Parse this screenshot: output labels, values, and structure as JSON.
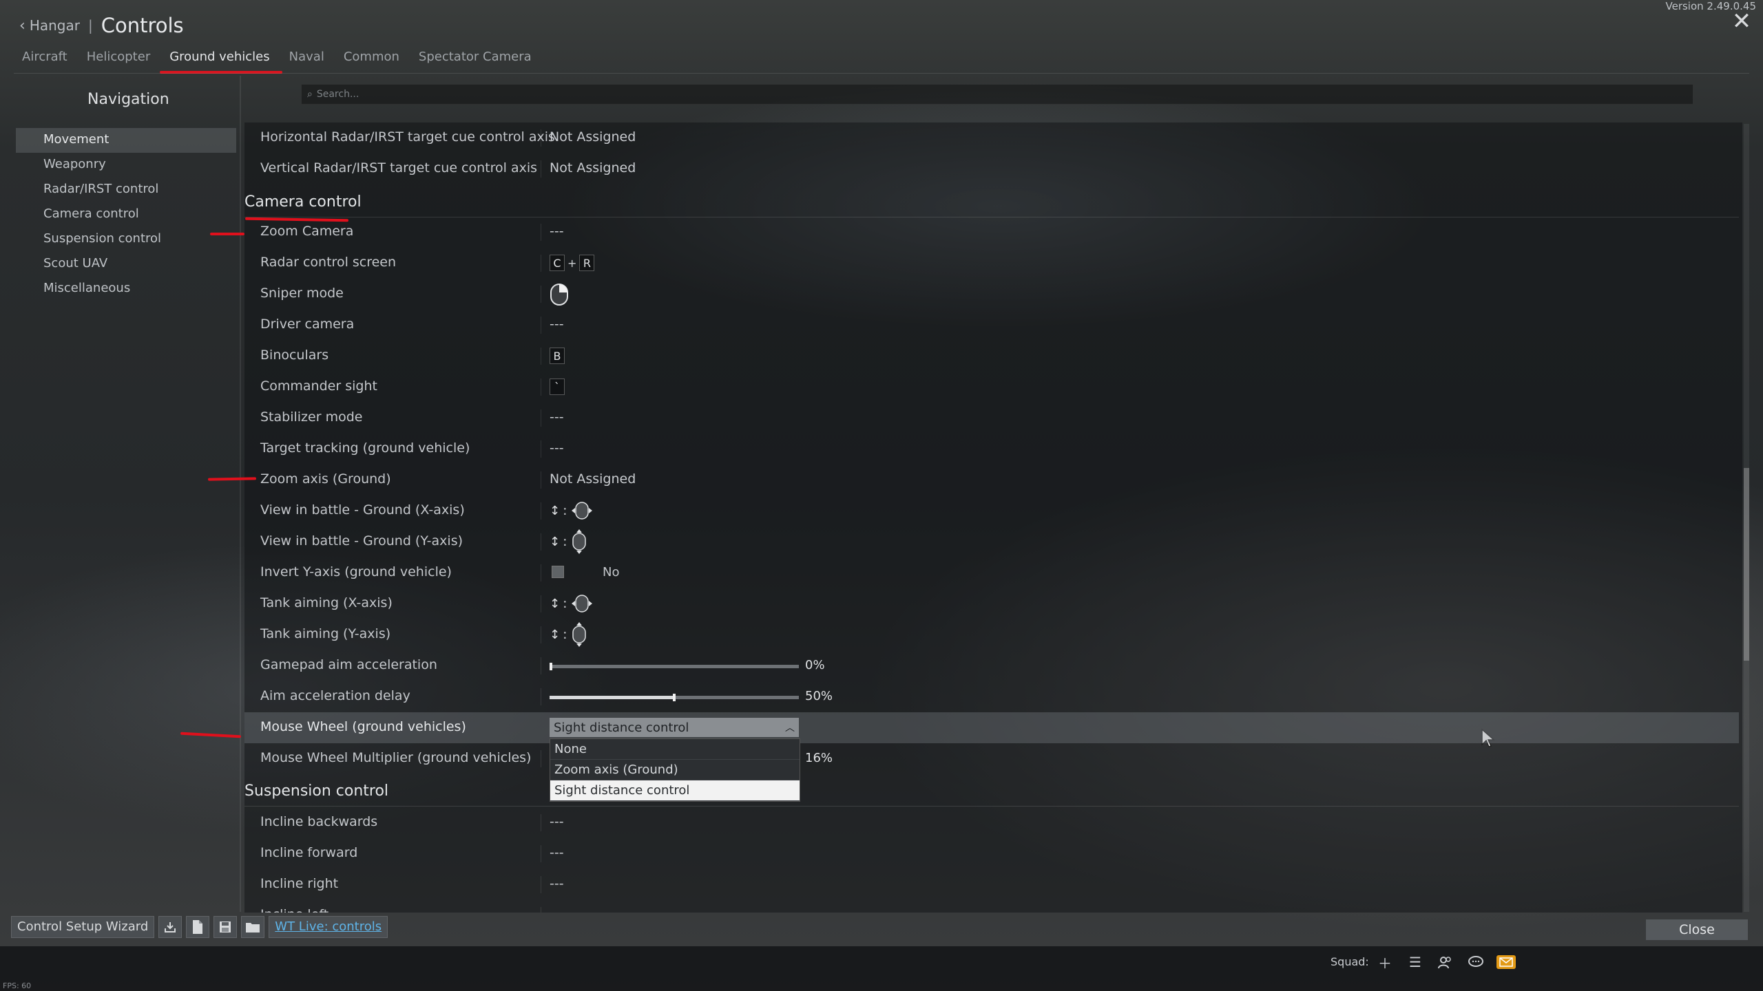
{
  "header": {
    "version": "Version 2.49.0.45",
    "back_label": "Hangar",
    "title_separator": "|",
    "title": "Controls"
  },
  "tabs": [
    {
      "label": "Aircraft",
      "active": false
    },
    {
      "label": "Helicopter",
      "active": false
    },
    {
      "label": "Ground vehicles",
      "active": true
    },
    {
      "label": "Naval",
      "active": false
    },
    {
      "label": "Common",
      "active": false
    },
    {
      "label": "Spectator Camera",
      "active": false
    }
  ],
  "search": {
    "placeholder": "Search..."
  },
  "nav": {
    "title": "Navigation",
    "items": [
      {
        "label": "Movement",
        "active": true
      },
      {
        "label": "Weaponry",
        "active": false
      },
      {
        "label": "Radar/IRST control",
        "active": false
      },
      {
        "label": "Camera control",
        "active": false
      },
      {
        "label": "Suspension control",
        "active": false
      },
      {
        "label": "Scout UAV",
        "active": false
      },
      {
        "label": "Miscellaneous",
        "active": false
      }
    ]
  },
  "rows_top": [
    {
      "label": "Horizontal Radar/IRST target cue control axis",
      "value": "Not Assigned"
    },
    {
      "label": "Vertical Radar/IRST target cue control axis",
      "value": "Not Assigned"
    }
  ],
  "camera_section": {
    "title": "Camera control",
    "zoom_camera": {
      "label": "Zoom Camera",
      "value": "---"
    },
    "radar_screen": {
      "label": "Radar control screen",
      "key1": "C",
      "plus": "+",
      "key2": "R"
    },
    "sniper": {
      "label": "Sniper mode",
      "icon": "mouse-right-button-icon"
    },
    "driver": {
      "label": "Driver camera",
      "value": "---"
    },
    "binoculars": {
      "label": "Binoculars",
      "key": "B"
    },
    "commander": {
      "label": "Commander sight",
      "key": "`"
    },
    "stabilizer": {
      "label": "Stabilizer mode",
      "value": "---"
    },
    "tracking": {
      "label": "Target tracking (ground vehicle)",
      "value": "---"
    },
    "zoom_axis": {
      "label": "Zoom axis (Ground)",
      "value": "Not Assigned"
    },
    "view_x": {
      "label": "View in battle - Ground (X-axis)",
      "colon": ":"
    },
    "view_y": {
      "label": "View in battle - Ground (Y-axis)",
      "colon": ":"
    },
    "invert_y": {
      "label": "Invert Y-axis (ground vehicle)",
      "value": "No",
      "checked": false
    },
    "tank_x": {
      "label": "Tank aiming (X-axis)",
      "colon": ":"
    },
    "tank_y": {
      "label": "Tank aiming (Y-axis)",
      "colon": ":"
    },
    "gamepad_accel": {
      "label": "Gamepad aim acceleration",
      "percent": "0%",
      "level": 0
    },
    "aim_delay": {
      "label": "Aim acceleration delay",
      "percent": "50%",
      "level": 0.5
    },
    "mouse_wheel": {
      "label": "Mouse Wheel (ground vehicles)",
      "selected": "Sight distance control",
      "options": [
        "None",
        "Zoom axis (Ground)",
        "Sight distance control"
      ]
    },
    "wheel_mult": {
      "label": "Mouse Wheel Multiplier (ground vehicles)",
      "percent": "16%",
      "level": 0.16
    }
  },
  "suspension_section": {
    "title": "Suspension control",
    "rows": [
      {
        "label": "Incline backwards",
        "value": "---"
      },
      {
        "label": "Incline forward",
        "value": "---"
      },
      {
        "label": "Incline right",
        "value": "---"
      },
      {
        "label": "Incline left",
        "value": "---"
      }
    ]
  },
  "bottom": {
    "wizard_label": "Control Setup Wizard",
    "wt_live_label": "WT Live: controls",
    "close_label": "Close"
  },
  "footer": {
    "squad_label": "Squad:",
    "fps": "FPS: 60"
  },
  "colors": {
    "accent_red": "#d8141e",
    "link_blue": "#5fb4e8",
    "mail_orange": "#e39a16"
  }
}
